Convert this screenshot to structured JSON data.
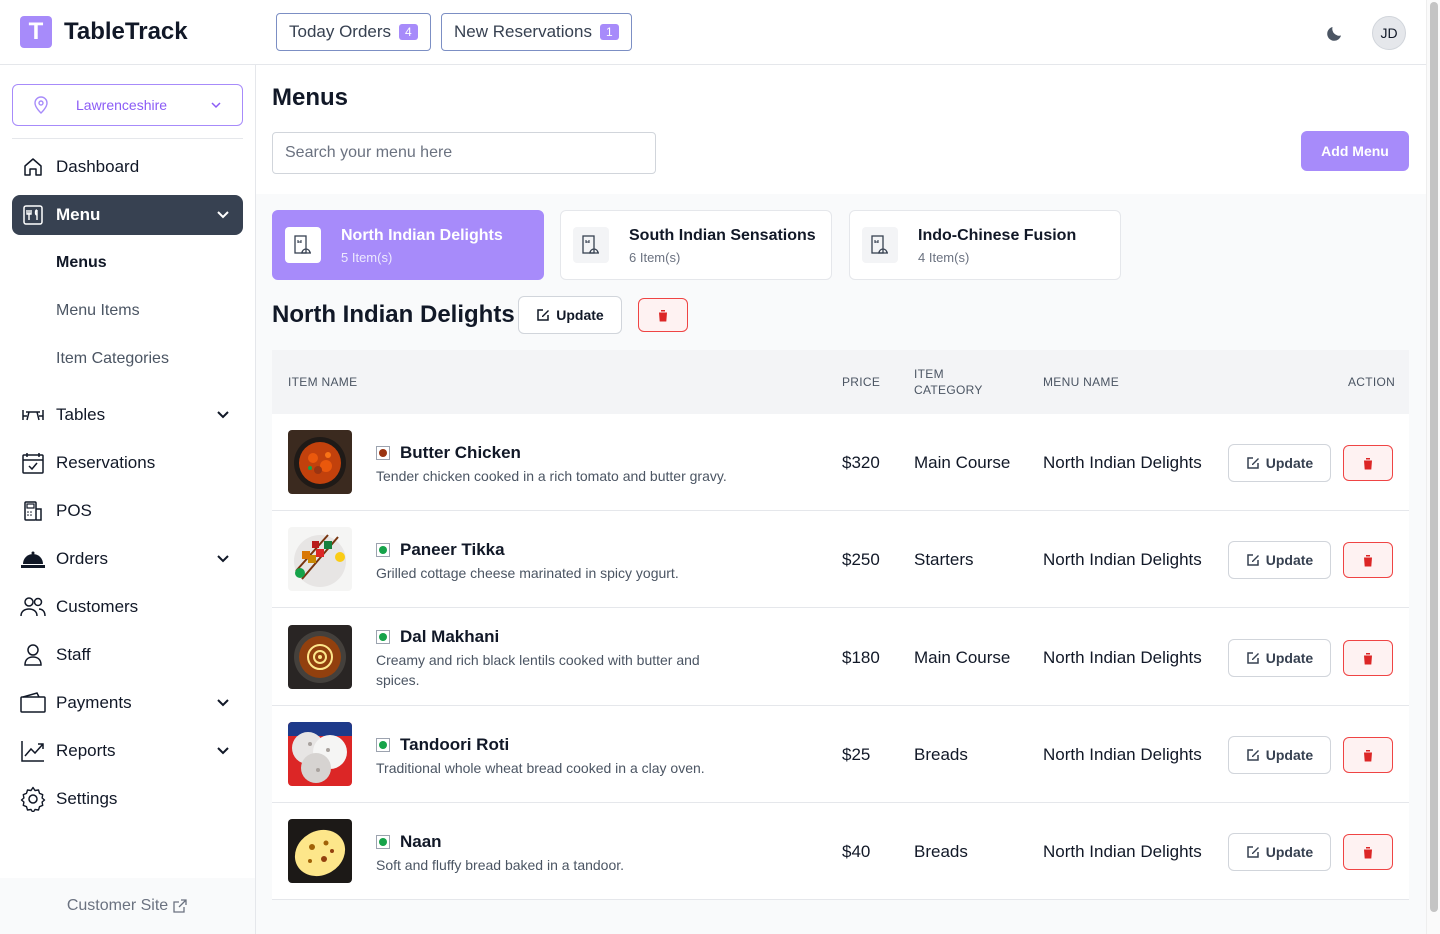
{
  "app": {
    "logo_letter": "T",
    "title": "TableTrack"
  },
  "header": {
    "today_orders": {
      "label": "Today Orders",
      "count": "4"
    },
    "new_reservations": {
      "label": "New Reservations",
      "count": "1"
    },
    "avatar_initials": "JD"
  },
  "sidebar": {
    "location": "Lawrenceshire",
    "items": [
      {
        "label": "Dashboard",
        "icon": "home-icon"
      },
      {
        "label": "Menu",
        "icon": "menu-icon",
        "active": true
      },
      {
        "label": "Tables",
        "icon": "table-icon"
      },
      {
        "label": "Reservations",
        "icon": "calendar-icon"
      },
      {
        "label": "POS",
        "icon": "pos-icon"
      },
      {
        "label": "Orders",
        "icon": "cloche-icon"
      },
      {
        "label": "Customers",
        "icon": "users-icon"
      },
      {
        "label": "Staff",
        "icon": "user-icon"
      },
      {
        "label": "Payments",
        "icon": "wallet-icon"
      },
      {
        "label": "Reports",
        "icon": "chart-icon"
      },
      {
        "label": "Settings",
        "icon": "gear-icon"
      }
    ],
    "submenu": [
      "Menus",
      "Menu Items",
      "Item Categories"
    ],
    "footer": "Customer Site"
  },
  "main": {
    "title": "Menus",
    "search_placeholder": "Search your menu here",
    "add_button": "Add Menu",
    "menus": [
      {
        "name": "North Indian Delights",
        "count": "5 Item(s)",
        "selected": true
      },
      {
        "name": "South Indian Sensations",
        "count": "6 Item(s)"
      },
      {
        "name": "Indo-Chinese Fusion",
        "count": "4 Item(s)"
      }
    ],
    "section_title": "North Indian Delights",
    "update_label": "Update",
    "table": {
      "headers": {
        "item_name": "ITEM NAME",
        "price": "PRICE",
        "item_category_1": "ITEM",
        "item_category_2": "CATEGORY",
        "menu_name": "MENU NAME",
        "action": "ACTION"
      },
      "rows": [
        {
          "name": "Butter Chicken",
          "desc": "Tender chicken cooked in a rich tomato and butter gravy.",
          "price": "$320",
          "category": "Main Course",
          "menu": "North Indian Delights",
          "type": "non-veg"
        },
        {
          "name": "Paneer Tikka",
          "desc": "Grilled cottage cheese marinated in spicy yogurt.",
          "price": "$250",
          "category": "Starters",
          "menu": "North Indian Delights",
          "type": "veg"
        },
        {
          "name": "Dal Makhani",
          "desc": "Creamy and rich black lentils cooked with butter and spices.",
          "price": "$180",
          "category": "Main Course",
          "menu": "North Indian Delights",
          "type": "veg"
        },
        {
          "name": "Tandoori Roti",
          "desc": "Traditional whole wheat bread cooked in a clay oven.",
          "price": "$25",
          "category": "Breads",
          "menu": "North Indian Delights",
          "type": "veg"
        },
        {
          "name": "Naan",
          "desc": "Soft and fluffy bread baked in a tandoor.",
          "price": "$40",
          "category": "Breads",
          "menu": "North Indian Delights",
          "type": "veg"
        }
      ]
    }
  },
  "colors": {
    "accent": "#a78bfa",
    "active_nav": "#374151",
    "danger": "#ef4444",
    "veg": "#16a34a",
    "non_veg": "#9a3412"
  }
}
